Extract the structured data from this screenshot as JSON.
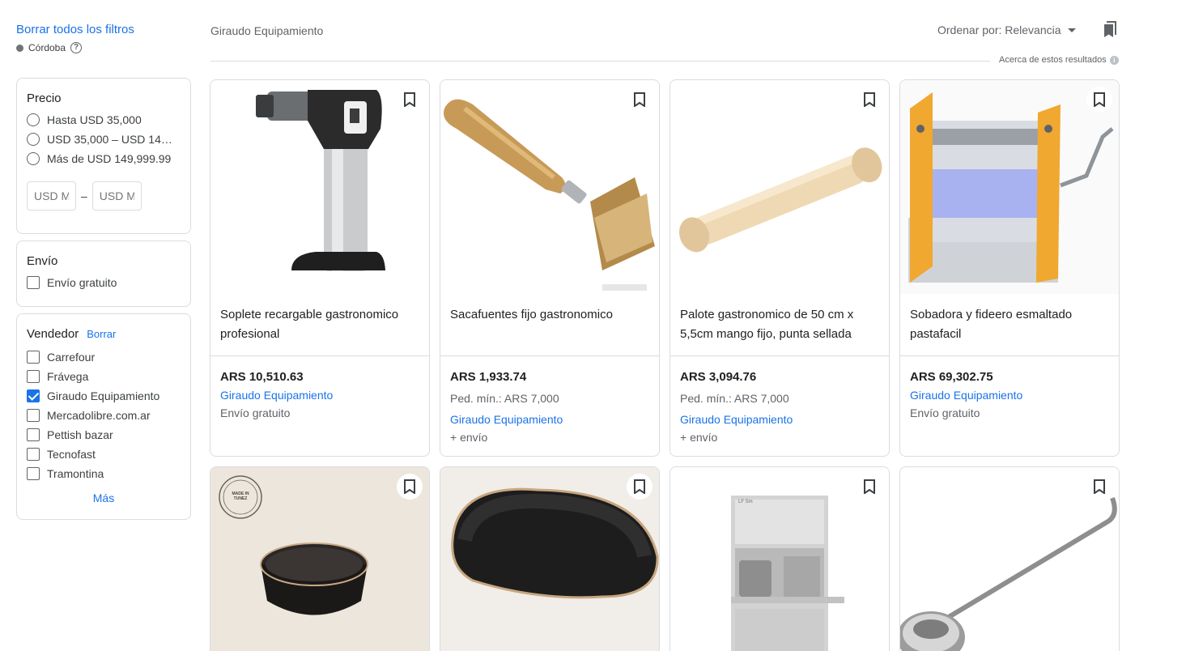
{
  "filters": {
    "clear_all": "Borrar todos los filtros",
    "location": "Córdoba",
    "price": {
      "title": "Precio",
      "options": [
        "Hasta USD 35,000",
        "USD 35,000 – USD 149…",
        "Más de USD 149,999.99"
      ],
      "min_placeholder": "USD M",
      "max_placeholder": "USD M",
      "dash": "–"
    },
    "shipping": {
      "title": "Envío",
      "options": [
        "Envío gratuito"
      ]
    },
    "seller": {
      "title": "Vendedor",
      "clear": "Borrar",
      "options": [
        "Carrefour",
        "Frávega",
        "Giraudo Equipamiento",
        "Mercadolibre.com.ar",
        "Pettish bazar",
        "Tecnofast",
        "Tramontina"
      ],
      "checked": "Giraudo Equipamiento",
      "more": "Más"
    }
  },
  "header": {
    "seller_filter": "Giraudo Equipamiento",
    "sort_label": "Ordenar por: Relevancia",
    "about_results": "Acerca de estos resultados"
  },
  "products": [
    {
      "title": "Soplete recargable gastronomico profesional",
      "price": "ARS 10,510.63",
      "seller": "Giraudo Equipamiento",
      "shipping": "Envío gratuito"
    },
    {
      "title": "Sacafuentes fijo gastronomico",
      "price": "ARS 1,933.74",
      "min_order": "Ped. mín.: ARS 7,000",
      "seller": "Giraudo Equipamiento",
      "shipping": "+ envío"
    },
    {
      "title": "Palote gastronomico de 50 cm x 5,5cm mango fijo, punta sellada",
      "price": "ARS 3,094.76",
      "min_order": "Ped. mín.: ARS 7,000",
      "seller": "Giraudo Equipamiento",
      "shipping": "+ envío"
    },
    {
      "title": "Sobadora y fideero esmaltado pastafacil",
      "price": "ARS 69,302.75",
      "seller": "Giraudo Equipamiento",
      "shipping": "Envío gratuito"
    },
    {
      "badge": "MADE IN TUNEZ"
    },
    {},
    {
      "machine_label": "LF Sm"
    },
    {}
  ]
}
